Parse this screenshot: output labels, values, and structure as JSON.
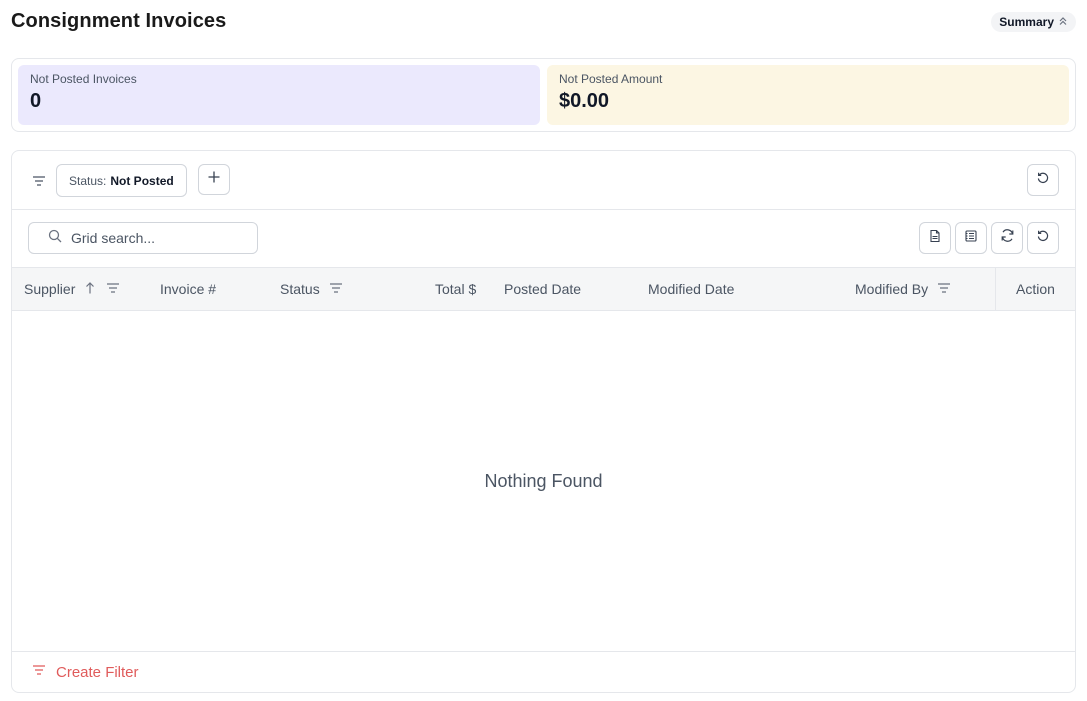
{
  "header": {
    "title": "Consignment Invoices",
    "summary_toggle_label": "Summary"
  },
  "summary": {
    "cards": [
      {
        "label": "Not Posted Invoices",
        "value": "0",
        "color": "#ebe9fd"
      },
      {
        "label": "Not Posted Amount",
        "value": "$0.00",
        "color": "#fcf6e3"
      }
    ]
  },
  "filters": {
    "chip": {
      "key": "Status:",
      "value": "Not Posted"
    }
  },
  "search": {
    "placeholder": "Grid search..."
  },
  "toolbar": {
    "icons": [
      "export-csv-icon",
      "export-excel-icon",
      "refresh-icon",
      "reset-icon"
    ]
  },
  "grid": {
    "columns": [
      {
        "label": "Supplier",
        "sort": "asc",
        "filterable": true
      },
      {
        "label": "Invoice #",
        "sortable": false,
        "filterable": false
      },
      {
        "label": "Status",
        "filterable": true
      },
      {
        "label": "Total $",
        "filterable": false
      },
      {
        "label": "Posted Date",
        "filterable": false
      },
      {
        "label": "Modified Date",
        "filterable": false
      },
      {
        "label": "Modified By",
        "filterable": true
      },
      {
        "label": "Action",
        "filterable": false
      }
    ],
    "rows": [],
    "empty_message": "Nothing Found"
  },
  "footer": {
    "create_filter_label": "Create Filter",
    "accent_color": "#e05b5b"
  }
}
